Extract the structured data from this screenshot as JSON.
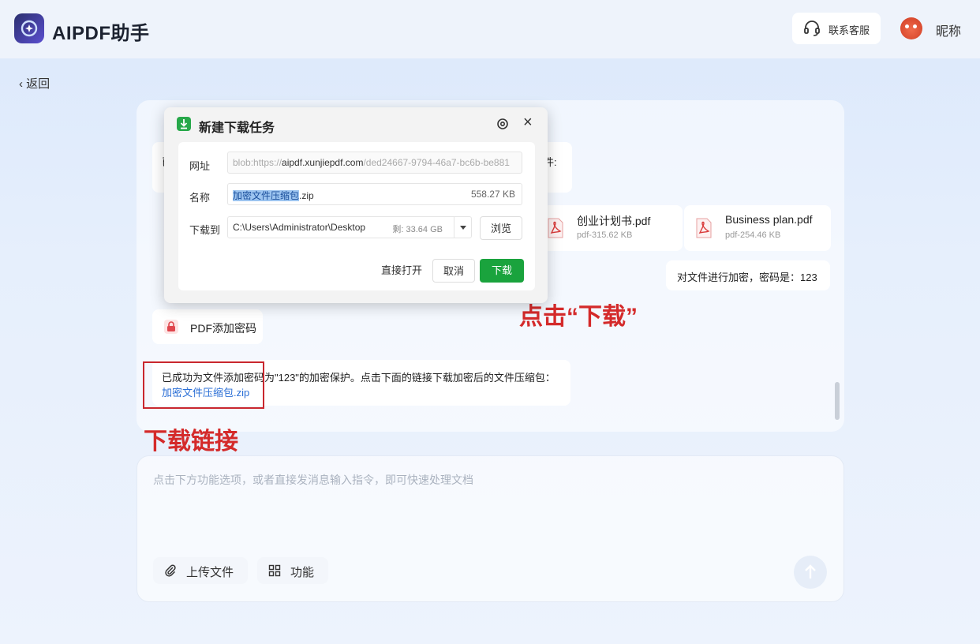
{
  "header": {
    "app_title": "AIPDF助手",
    "support_label": "联系客服",
    "nickname": "昵称"
  },
  "nav": {
    "back_label": "返回"
  },
  "chat": {
    "partial_top_left": "已",
    "partial_top_right": "件:",
    "files": [
      {
        "name": "创业计划书.pdf",
        "meta": "pdf-315.62 KB"
      },
      {
        "name": "Business plan.pdf",
        "meta": "pdf-254.46 KB"
      }
    ],
    "user_message": "对文件进行加密，密码是：123",
    "tool_tag": "PDF添加密码",
    "result_message": "已成功为文件添加密码为\"123\"的加密保护。点击下面的链接下载加密后的文件压缩包：",
    "result_link": "加密文件压缩包.zip"
  },
  "annotations": {
    "click_download": "点击“下载”",
    "download_link": "下载链接"
  },
  "input": {
    "placeholder": "点击下方功能选项，或者直接发消息输入指令，即可快速处理文档",
    "upload_label": "上传文件",
    "function_label": "功能"
  },
  "dialog": {
    "title": "新建下载任务",
    "url_label": "网址",
    "url_prefix": "blob:https://",
    "url_domain": "aipdf.xunjiepdf.com",
    "url_suffix": "/ded24667-9794-46a7-bc6b-be881",
    "name_label": "名称",
    "name_selected": "加密文件压缩包",
    "name_ext": ".zip",
    "file_size": "558.27 KB",
    "save_label": "下载到",
    "save_path": "C:\\Users\\Administrator\\Desktop",
    "free_space": "剩: 33.64 GB",
    "browse_label": "浏览",
    "open_label": "直接打开",
    "cancel_label": "取消",
    "download_label": "下载"
  },
  "colors": {
    "accent_green": "#1aa33d",
    "link_blue": "#2b6fd6",
    "annotation_red": "#d42a2a"
  }
}
